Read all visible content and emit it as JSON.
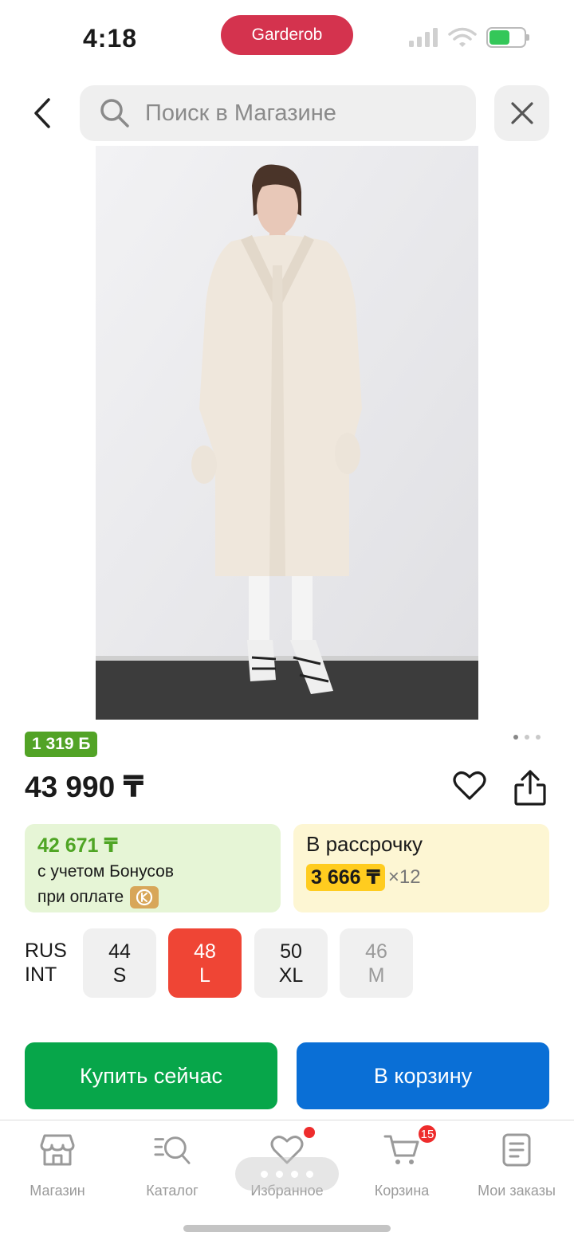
{
  "status_bar": {
    "time": "4:18",
    "app_pill": "Garderob",
    "battery_level": 0.6,
    "battery_color": "#34c759"
  },
  "header": {
    "search_placeholder": "Поиск в Магазине",
    "back_icon": "chevron-left-icon",
    "search_icon": "search-icon",
    "close_icon": "close-icon"
  },
  "product": {
    "image_alt": "Product photo",
    "gallery_count": 3,
    "gallery_active": 1,
    "bonus_badge": "1 319 Б",
    "price": "43 990 ₸",
    "favorite_icon": "heart-icon",
    "share_icon": "share-icon"
  },
  "bonus_card": {
    "amount": "42 671 ₸",
    "line1": "с учетом Бонусов",
    "line2": "при оплате"
  },
  "installment_card": {
    "title": "В рассрочку",
    "monthly": "3 666 ₸",
    "multiplier": "×12"
  },
  "sizes": {
    "label_system": "RUS",
    "label_int": "INT",
    "options": [
      {
        "rus": "44",
        "int": "S",
        "state": "available"
      },
      {
        "rus": "48",
        "int": "L",
        "state": "selected"
      },
      {
        "rus": "50",
        "int": "XL",
        "state": "available"
      },
      {
        "rus": "46",
        "int": "M",
        "state": "disabled"
      }
    ]
  },
  "actions": {
    "buy_now": "Купить сейчас",
    "add_to_cart": "В корзину"
  },
  "bottom_nav": {
    "items": [
      {
        "label": "Магазин",
        "icon": "store-icon"
      },
      {
        "label": "Каталог",
        "icon": "catalog-search-icon"
      },
      {
        "label": "Избранное",
        "icon": "heart-icon"
      },
      {
        "label": "Корзина",
        "icon": "cart-icon",
        "badge": "15"
      },
      {
        "label": "Мои заказы",
        "icon": "orders-icon"
      }
    ]
  },
  "colors": {
    "brand_red": "#d4334e",
    "accent_green": "#07a64a",
    "accent_blue": "#0a6fd6",
    "size_selected": "#ef4535",
    "bonus_green": "#52a326",
    "installment_yellow": "#ffcc1f"
  }
}
